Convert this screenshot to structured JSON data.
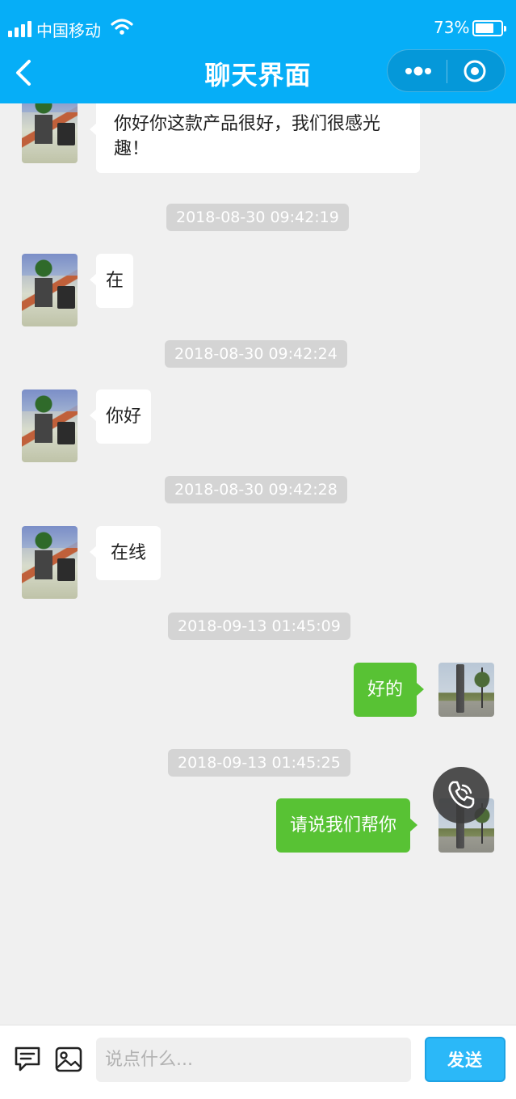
{
  "status_bar": {
    "carrier": "中国移动",
    "battery_percent": "73%",
    "battery_level": 0.73
  },
  "header": {
    "title": "聊天界面",
    "icons": [
      "back-chevron-icon",
      "more-dots-icon",
      "target-circle-icon"
    ]
  },
  "messages": [
    {
      "type": "text",
      "side": "left",
      "avatar": "office-avatar",
      "text": "你好你这款产品很好，我们很感光趣！"
    },
    {
      "type": "timestamp",
      "text": "2018-08-30 09:42:19"
    },
    {
      "type": "text",
      "side": "left",
      "avatar": "office-avatar",
      "text": "在"
    },
    {
      "type": "timestamp",
      "text": "2018-08-30 09:42:24"
    },
    {
      "type": "text",
      "side": "left",
      "avatar": "office-avatar",
      "text": "你好"
    },
    {
      "type": "timestamp",
      "text": "2018-08-30 09:42:28"
    },
    {
      "type": "text",
      "side": "left",
      "avatar": "office-avatar",
      "text": "在线"
    },
    {
      "type": "timestamp",
      "text": "2018-09-13 01:45:09"
    },
    {
      "type": "text",
      "side": "right",
      "avatar": "road-avatar",
      "text": "好的"
    },
    {
      "type": "timestamp",
      "text": "2018-09-13 01:45:25"
    },
    {
      "type": "text",
      "side": "right",
      "avatar": "road-avatar",
      "text": "请说我们帮你"
    }
  ],
  "footer": {
    "input_placeholder": "说点什么...",
    "send_label": "发送",
    "icons": [
      "message-icon",
      "image-icon"
    ]
  },
  "colors": {
    "header_bg": "#06aef7",
    "page_bg": "#f0f0f0",
    "outgoing_bubble": "#58c234",
    "incoming_bubble": "#ffffff",
    "send_button": "#2bb8f8",
    "timestamp_bg": "#d4d4d4"
  },
  "call_button_icon": "phone-icon"
}
